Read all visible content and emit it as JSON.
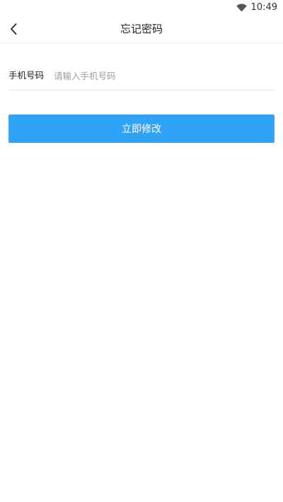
{
  "status_bar": {
    "time": "10:49",
    "wifi_icon": "wifi-icon"
  },
  "app_bar": {
    "back_icon": "chevron-left-icon",
    "title": "忘记密码"
  },
  "form": {
    "phone_label": "手机号码",
    "phone_placeholder": "请输入手机号码",
    "phone_value": ""
  },
  "submit_button": {
    "label": "立即修改"
  },
  "colors": {
    "accent": "#2ea3f8",
    "background": "#ffffff",
    "text": "#222222",
    "placeholder": "#9e9e9e"
  }
}
